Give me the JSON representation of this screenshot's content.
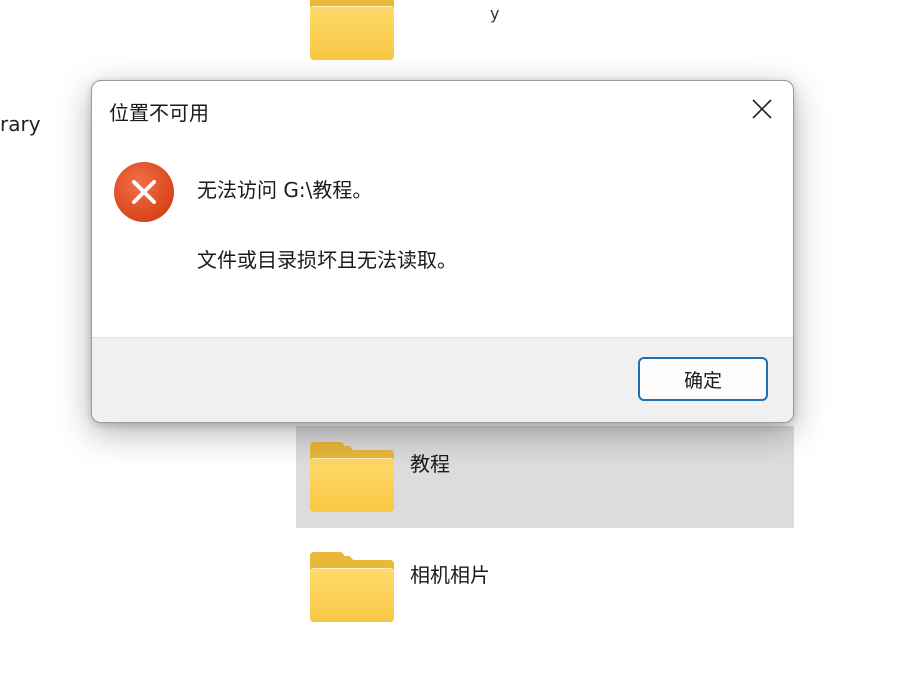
{
  "background": {
    "left_label": "rary",
    "top_fragment": "y",
    "folders": [
      {
        "label": "教程",
        "selected": true
      },
      {
        "label": "相机相片",
        "selected": false
      }
    ],
    "colors": {
      "selected_row": "#dcdcdc",
      "folder_front": "#f8c843",
      "folder_back": "#e9b73a"
    }
  },
  "dialog": {
    "title": "位置不可用",
    "close_icon": "close-icon",
    "error_icon": "error-icon",
    "message_primary": "无法访问 G:\\教程。",
    "message_secondary": "文件或目录损坏且无法读取。",
    "ok_label": "确定",
    "colors": {
      "error_icon": "#e0461f",
      "ok_border": "#1f6fb5",
      "footer": "#f0f0f0"
    }
  }
}
